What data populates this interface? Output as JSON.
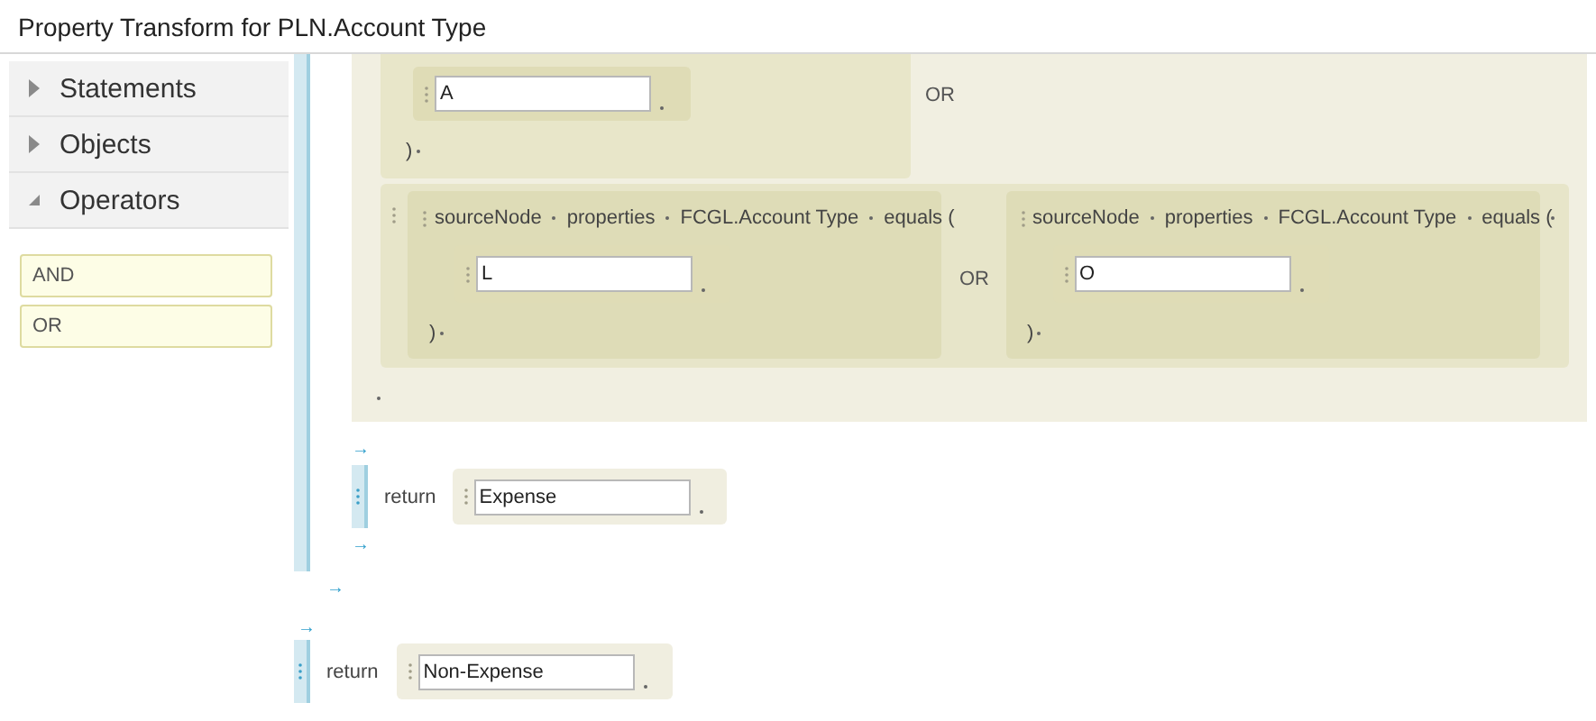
{
  "window": {
    "title": "Property Transform for PLN.Account Type"
  },
  "sidebar": {
    "sections": [
      {
        "label": "Statements",
        "expanded": false
      },
      {
        "label": "Objects",
        "expanded": false
      },
      {
        "label": "Operators",
        "expanded": true
      }
    ],
    "palette": [
      {
        "label": "AND"
      },
      {
        "label": "OR"
      }
    ]
  },
  "editor": {
    "partial_condition": {
      "value": "A",
      "close": ")",
      "joiner": "OR"
    },
    "condition_row": {
      "conditions": [
        {
          "tokens": [
            "sourceNode",
            "properties",
            "FCGL.Account Type",
            "equals ("
          ],
          "value": "L",
          "close": ")"
        },
        {
          "tokens": [
            "sourceNode",
            "properties",
            "FCGL.Account Type",
            "equals ("
          ],
          "value": "O",
          "close": ")"
        }
      ],
      "joiner": "OR"
    },
    "arrow_before_return": "→",
    "inner_return": {
      "keyword": "return",
      "value": "Expense"
    },
    "arrow_after_return": "→",
    "end_arrow": "→",
    "else_arrow": "→",
    "final_return": {
      "keyword": "return",
      "value": "Non-Expense"
    }
  }
}
